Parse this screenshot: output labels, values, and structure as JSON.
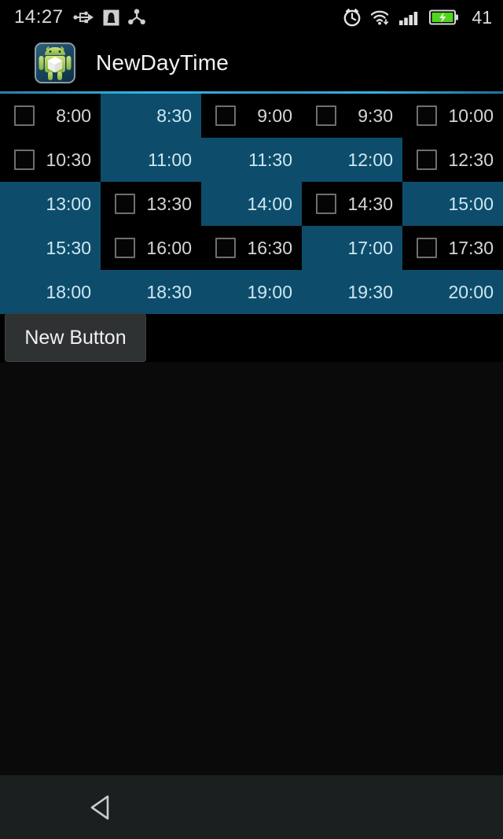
{
  "status_bar": {
    "clock": "14:27",
    "battery_text": "41",
    "left_icons": [
      "usb-icon",
      "notification-icon",
      "share-icon"
    ],
    "right_icons": [
      "alarm-icon",
      "wifi-icon",
      "signal-icon",
      "battery-charging-icon"
    ]
  },
  "action_bar": {
    "title": "NewDayTime",
    "icon": "android-app-icon",
    "accent_color": "#33b5e5"
  },
  "colors": {
    "selected_cell": "#0d4d6b",
    "unselected_cell": "#000000",
    "selected_text": "#cfe6f2",
    "unselected_text": "#d6d6d6",
    "button_bg": "#2f3233",
    "nav_bar_bg": "#1b1f1f"
  },
  "time_grid": {
    "columns": 5,
    "rows": [
      [
        {
          "label": "8:00",
          "selected": false
        },
        {
          "label": "8:30",
          "selected": true
        },
        {
          "label": "9:00",
          "selected": false
        },
        {
          "label": "9:30",
          "selected": false
        },
        {
          "label": "10:00",
          "selected": false
        }
      ],
      [
        {
          "label": "10:30",
          "selected": false
        },
        {
          "label": "11:00",
          "selected": true
        },
        {
          "label": "11:30",
          "selected": true
        },
        {
          "label": "12:00",
          "selected": true
        },
        {
          "label": "12:30",
          "selected": false
        }
      ],
      [
        {
          "label": "13:00",
          "selected": true
        },
        {
          "label": "13:30",
          "selected": false
        },
        {
          "label": "14:00",
          "selected": true
        },
        {
          "label": "14:30",
          "selected": false
        },
        {
          "label": "15:00",
          "selected": true
        }
      ],
      [
        {
          "label": "15:30",
          "selected": true
        },
        {
          "label": "16:00",
          "selected": false
        },
        {
          "label": "16:30",
          "selected": false
        },
        {
          "label": "17:00",
          "selected": true
        },
        {
          "label": "17:30",
          "selected": false
        }
      ],
      [
        {
          "label": "18:00",
          "selected": true
        },
        {
          "label": "18:30",
          "selected": true
        },
        {
          "label": "19:00",
          "selected": true
        },
        {
          "label": "19:30",
          "selected": true
        },
        {
          "label": "20:00",
          "selected": true
        }
      ]
    ]
  },
  "new_button": {
    "label": "New Button"
  },
  "nav_bar": {
    "back_icon": "back-triangle-icon"
  }
}
